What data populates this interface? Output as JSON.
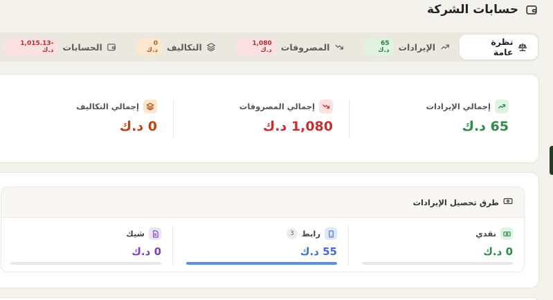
{
  "header": {
    "title": "حسابات الشركة",
    "icon": "wallet-icon"
  },
  "tabs": [
    {
      "label": "نظرة عامة",
      "icon": "scale-icon",
      "badge": "",
      "active": true
    },
    {
      "label": "الإيرادات",
      "icon": "trending-up-icon",
      "badge": "65 د.ك",
      "badge_color": "green"
    },
    {
      "label": "المصروفات",
      "icon": "trending-down-icon",
      "badge": "1,080 د.ك",
      "badge_color": "red"
    },
    {
      "label": "التكاليف",
      "icon": "layers-icon",
      "badge": "0 د.ك",
      "badge_color": "orange"
    },
    {
      "label": "الحسابات",
      "icon": "wallet-icon",
      "badge": "-1,015.13 د.ك",
      "badge_color": "red"
    }
  ],
  "summary": {
    "revenue": {
      "label": "إجمالي الإيرادات",
      "value": "65 د.ك",
      "color": "#2e8b47"
    },
    "expenses": {
      "label": "إجمالي المصروفات",
      "value": "1,080 د.ك",
      "color": "#c62f2f"
    },
    "costs": {
      "label": "إجمالي التكاليف",
      "value": "0 د.ك",
      "color": "#b8470f"
    }
  },
  "collection": {
    "title": "طرق تحصيل الإيرادات",
    "methods": [
      {
        "label": "نقدي",
        "value": "0 د.ك",
        "count": "",
        "color": "#2e8b47",
        "share": 0.0
      },
      {
        "label": "رابط",
        "value": "55 د.ك",
        "count": "3",
        "color": "#3f6fd6",
        "share": 1.0
      },
      {
        "label": "شيك",
        "value": "0 د.ك",
        "count": "",
        "color": "#7a3fc6",
        "share": 0.0
      }
    ]
  }
}
